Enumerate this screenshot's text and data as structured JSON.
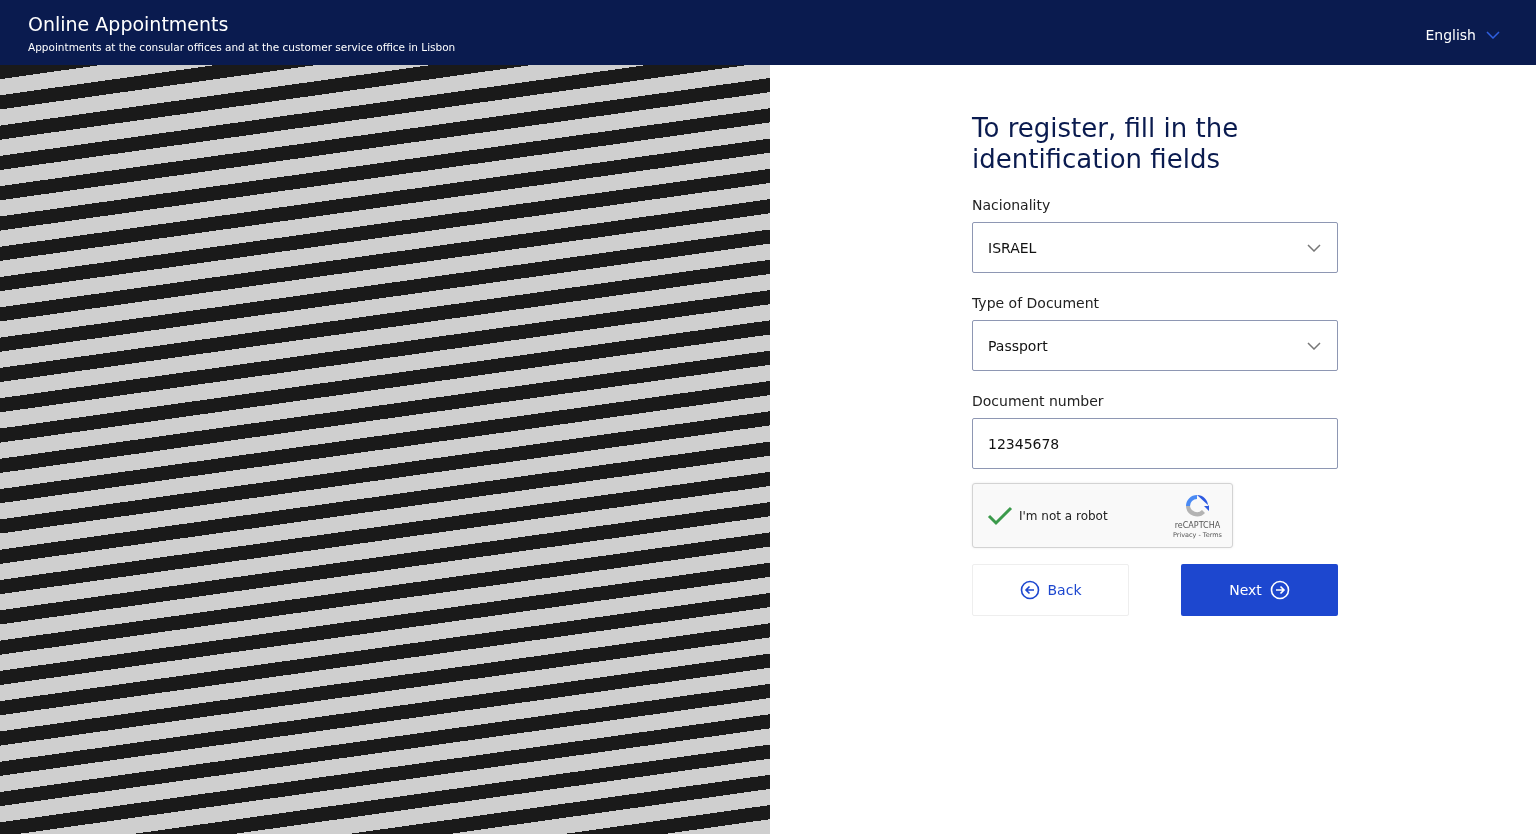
{
  "header": {
    "title": "Online Appointments",
    "subtitle": "Appointments at the consular offices and at the customer service office in Lisbon",
    "language": "English"
  },
  "form": {
    "heading": "To register, fill in the identification fields",
    "fields": [
      {
        "kind": "select",
        "label": "Nacionality",
        "value": "ISRAEL"
      },
      {
        "kind": "select",
        "label": "Type of Document",
        "value": "Passport"
      },
      {
        "kind": "text",
        "label": "Document number",
        "value": "12345678"
      }
    ],
    "captcha": {
      "label": "I'm not a robot",
      "checked": true,
      "brand": "reCAPTCHA",
      "privacy": "Privacy",
      "separator": "-",
      "terms": "Terms"
    },
    "buttons": [
      {
        "kind": "back",
        "label": "Back"
      },
      {
        "kind": "next",
        "label": "Next"
      }
    ]
  }
}
